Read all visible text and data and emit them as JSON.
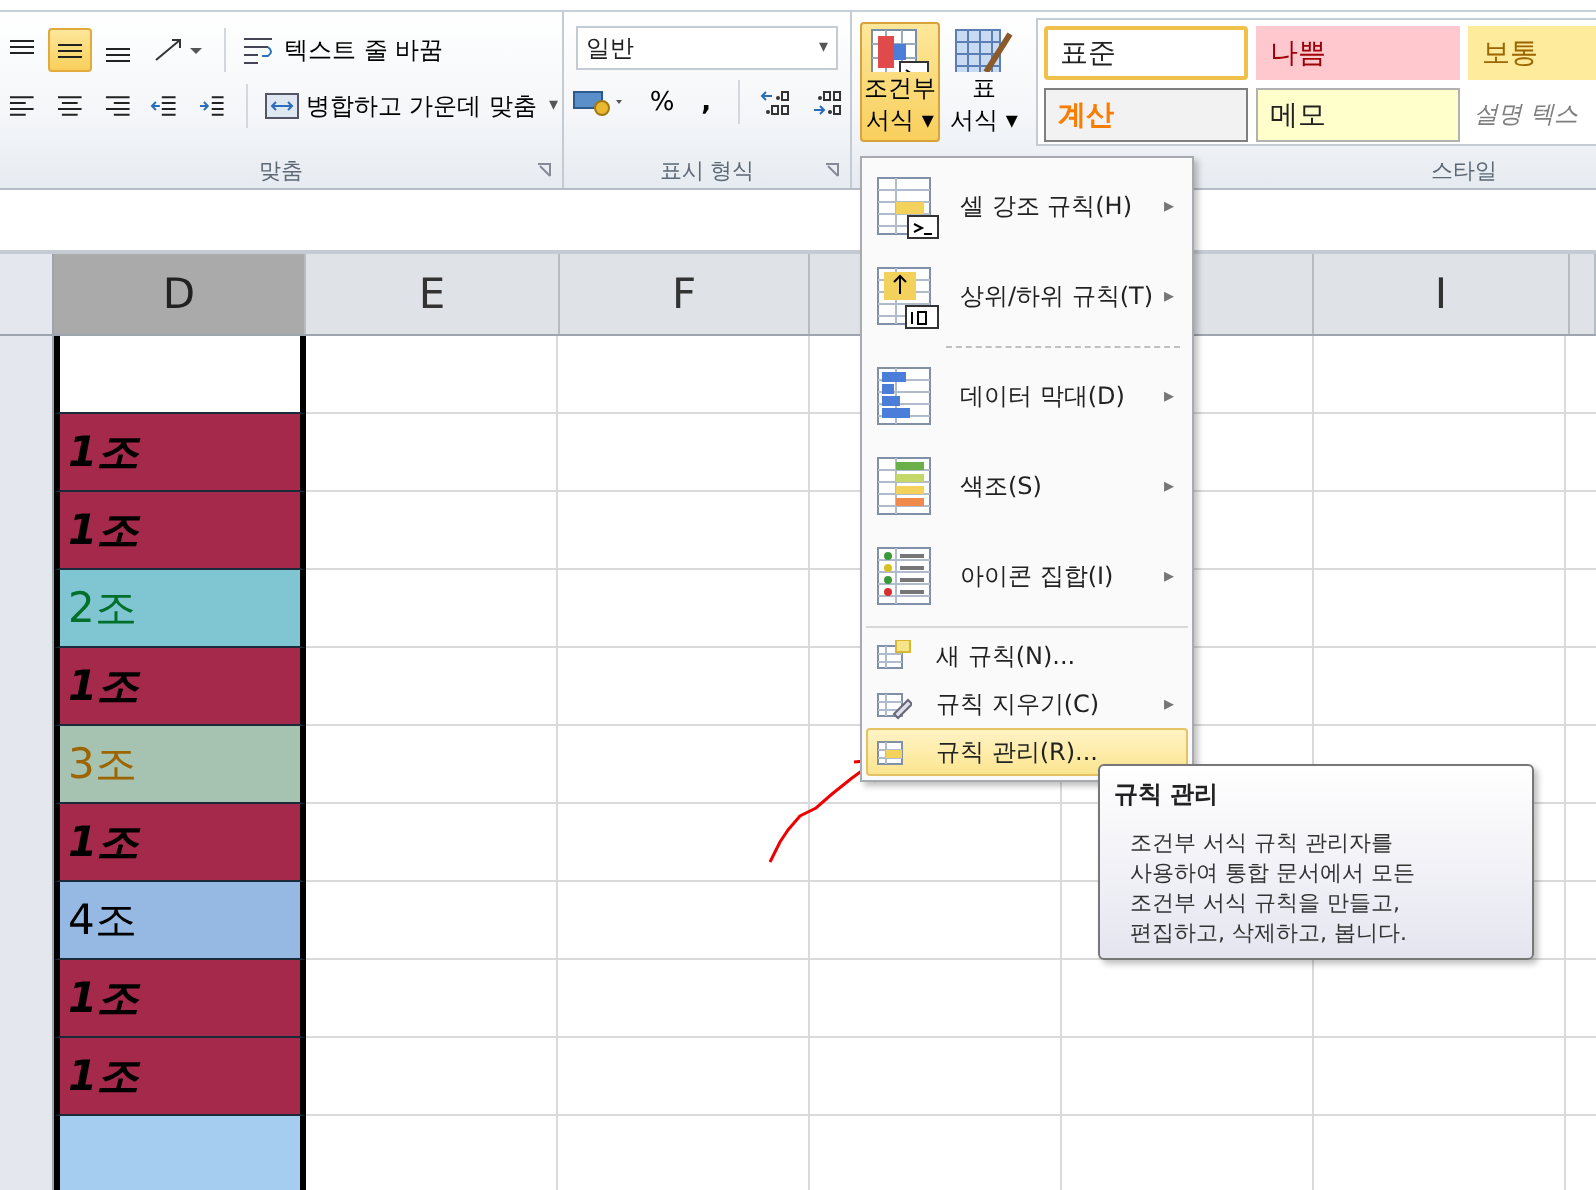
{
  "ribbon": {
    "alignment": {
      "buttons": [
        {
          "kind": "align-top",
          "selected": false
        },
        {
          "kind": "align-middle",
          "selected": true
        },
        {
          "kind": "align-bottom",
          "selected": false
        },
        {
          "kind": "orientation",
          "selected": false
        }
      ],
      "wrap_text": "텍스트 줄 바꿈",
      "buttons2": [
        {
          "kind": "align-left"
        },
        {
          "kind": "align-center"
        },
        {
          "kind": "align-right"
        },
        {
          "kind": "indent-decrease"
        },
        {
          "kind": "indent-increase"
        }
      ],
      "merge": "병합하고 가운데 맞춤",
      "merge_caret": "▾",
      "label": "맞춤"
    },
    "number": {
      "format": "일반",
      "format_caret": "▾",
      "percent": "%",
      "comma": ",",
      "label": "표시 형식"
    },
    "styles": {
      "conditional": {
        "lines": [
          "조건부",
          "서식"
        ],
        "caret": "▾",
        "selected": true
      },
      "table_format": {
        "lines": [
          "표",
          "서식"
        ],
        "caret": "▾"
      },
      "gallery": [
        {
          "text": "표준",
          "kind": "normal",
          "selected": true
        },
        {
          "text": "나쁨",
          "kind": "bad",
          "selected": false
        },
        {
          "text": "보통",
          "kind": "neutral",
          "selected": false
        },
        {
          "text": "계산",
          "kind": "calculation",
          "selected": false
        },
        {
          "text": "메모",
          "kind": "note",
          "selected": false
        },
        {
          "text": "설명 텍스",
          "kind": "explanatory",
          "selected": false
        }
      ],
      "label": "스타일"
    }
  },
  "columns": [
    {
      "label": "D",
      "selected": true
    },
    {
      "label": "E",
      "selected": false
    },
    {
      "label": "F",
      "selected": false
    },
    {
      "selected": false
    },
    {
      "selected": false
    },
    {
      "label": "I",
      "selected": false
    }
  ],
  "cells": [
    {
      "color": "#ffffff",
      "kind": "blank"
    },
    {
      "text": "1조",
      "color": "#a4294a",
      "kind": "bold"
    },
    {
      "text": "1조",
      "color": "#a4294a",
      "kind": "bold"
    },
    {
      "label": {
        "text": "2조",
        "color": "#00702a"
      },
      "color": "#80c5d2",
      "kind": "plain"
    },
    {
      "text": "1조",
      "color": "#a4294a",
      "kind": "bold"
    },
    {
      "label": {
        "text": "3조",
        "color": "#9c6500"
      },
      "color": "#a6c3b2",
      "kind": "plain"
    },
    {
      "text": "1조",
      "color": "#a4294a",
      "kind": "bold"
    },
    {
      "label": {
        "text": "4조",
        "color": "#000000"
      },
      "color": "#95b9e2",
      "kind": "plain"
    },
    {
      "text": "1조",
      "color": "#a4294a",
      "kind": "bold"
    },
    {
      "text": "1조",
      "color": "#a4294a",
      "kind": "bold"
    },
    {
      "color": "#a4cdef",
      "kind": "blank"
    }
  ],
  "menu": {
    "items": [
      {
        "label": "셀 강조 규칙(H)",
        "kind": "highlight",
        "submenu_arrow": "▸",
        "selected": false
      },
      {
        "label": "상위/하위 규칙(T)",
        "kind": "topbottom",
        "submenu_arrow": "▸",
        "selected": false
      },
      {
        "label": "데이터 막대(D)",
        "kind": "databar",
        "submenu_arrow": "▸",
        "selected": false
      },
      {
        "label": "색조(S)",
        "kind": "colorscale",
        "submenu_arrow": "▸",
        "selected": false
      },
      {
        "label": "아이콘 집합(I)",
        "kind": "iconset",
        "submenu_arrow": "▸",
        "selected": false
      },
      {
        "label": "새 규칙(N)...",
        "kind": "new",
        "selected": false
      },
      {
        "label": "규칙 지우기(C)",
        "kind": "clear",
        "submenu_arrow": "▸",
        "selected": false
      },
      {
        "label": "규칙 관리(R)...",
        "kind": "manage",
        "selected": true
      }
    ]
  },
  "tooltip": {
    "title": "규칙 관리",
    "body": "조건부 서식 규칙 관리자를\n사용하여 통합 문서에서 모든\n조건부 서식 규칙을 만들고,\n편집하고, 삭제하고, 봅니다."
  }
}
